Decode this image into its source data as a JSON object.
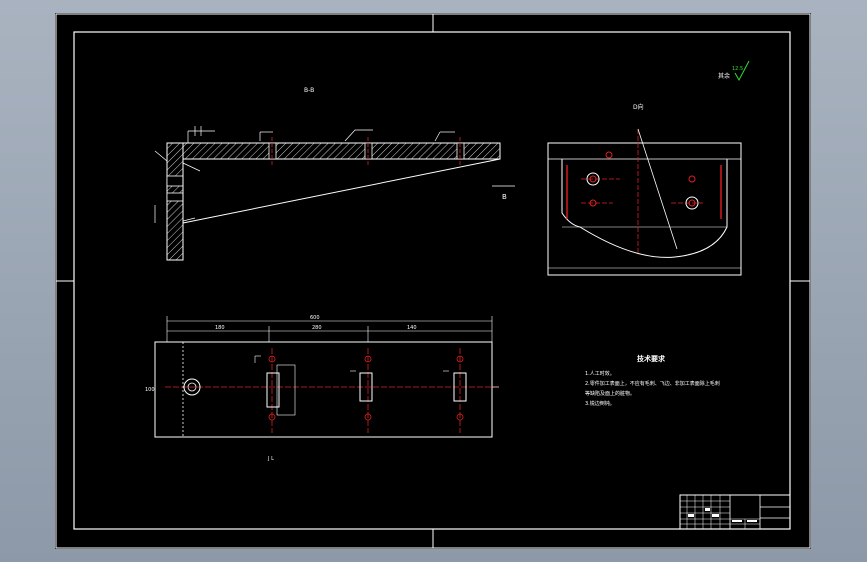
{
  "drawing": {
    "background_color": "#000000",
    "line_color": "#ffffff",
    "center_line_color": "#e02020",
    "hatch_color": "#ffffff",
    "labels": {
      "section_label_top": "B-B",
      "view_label_right": "D向",
      "view_arrow_b": "B",
      "view_label_bottom_left": "J L",
      "roughness_corner_label": "其余",
      "roughness_value": "12.5",
      "dim_overall_top": "600",
      "dim_segment_1": "180",
      "dim_segment_2": "280",
      "dim_segment_3": "140",
      "dim_height_left": "100"
    }
  },
  "technical_requirements": {
    "title": "技术要求",
    "items": [
      "1.人工时效。",
      "2.零件加工表面上，不应有毛刺、飞边、非加工表面除上毛刺",
      "等缺陷及面上的脏物。",
      "3.锐边倒钝。"
    ]
  },
  "title_block": {
    "cells": [
      "",
      "",
      "",
      "",
      "",
      ""
    ]
  }
}
